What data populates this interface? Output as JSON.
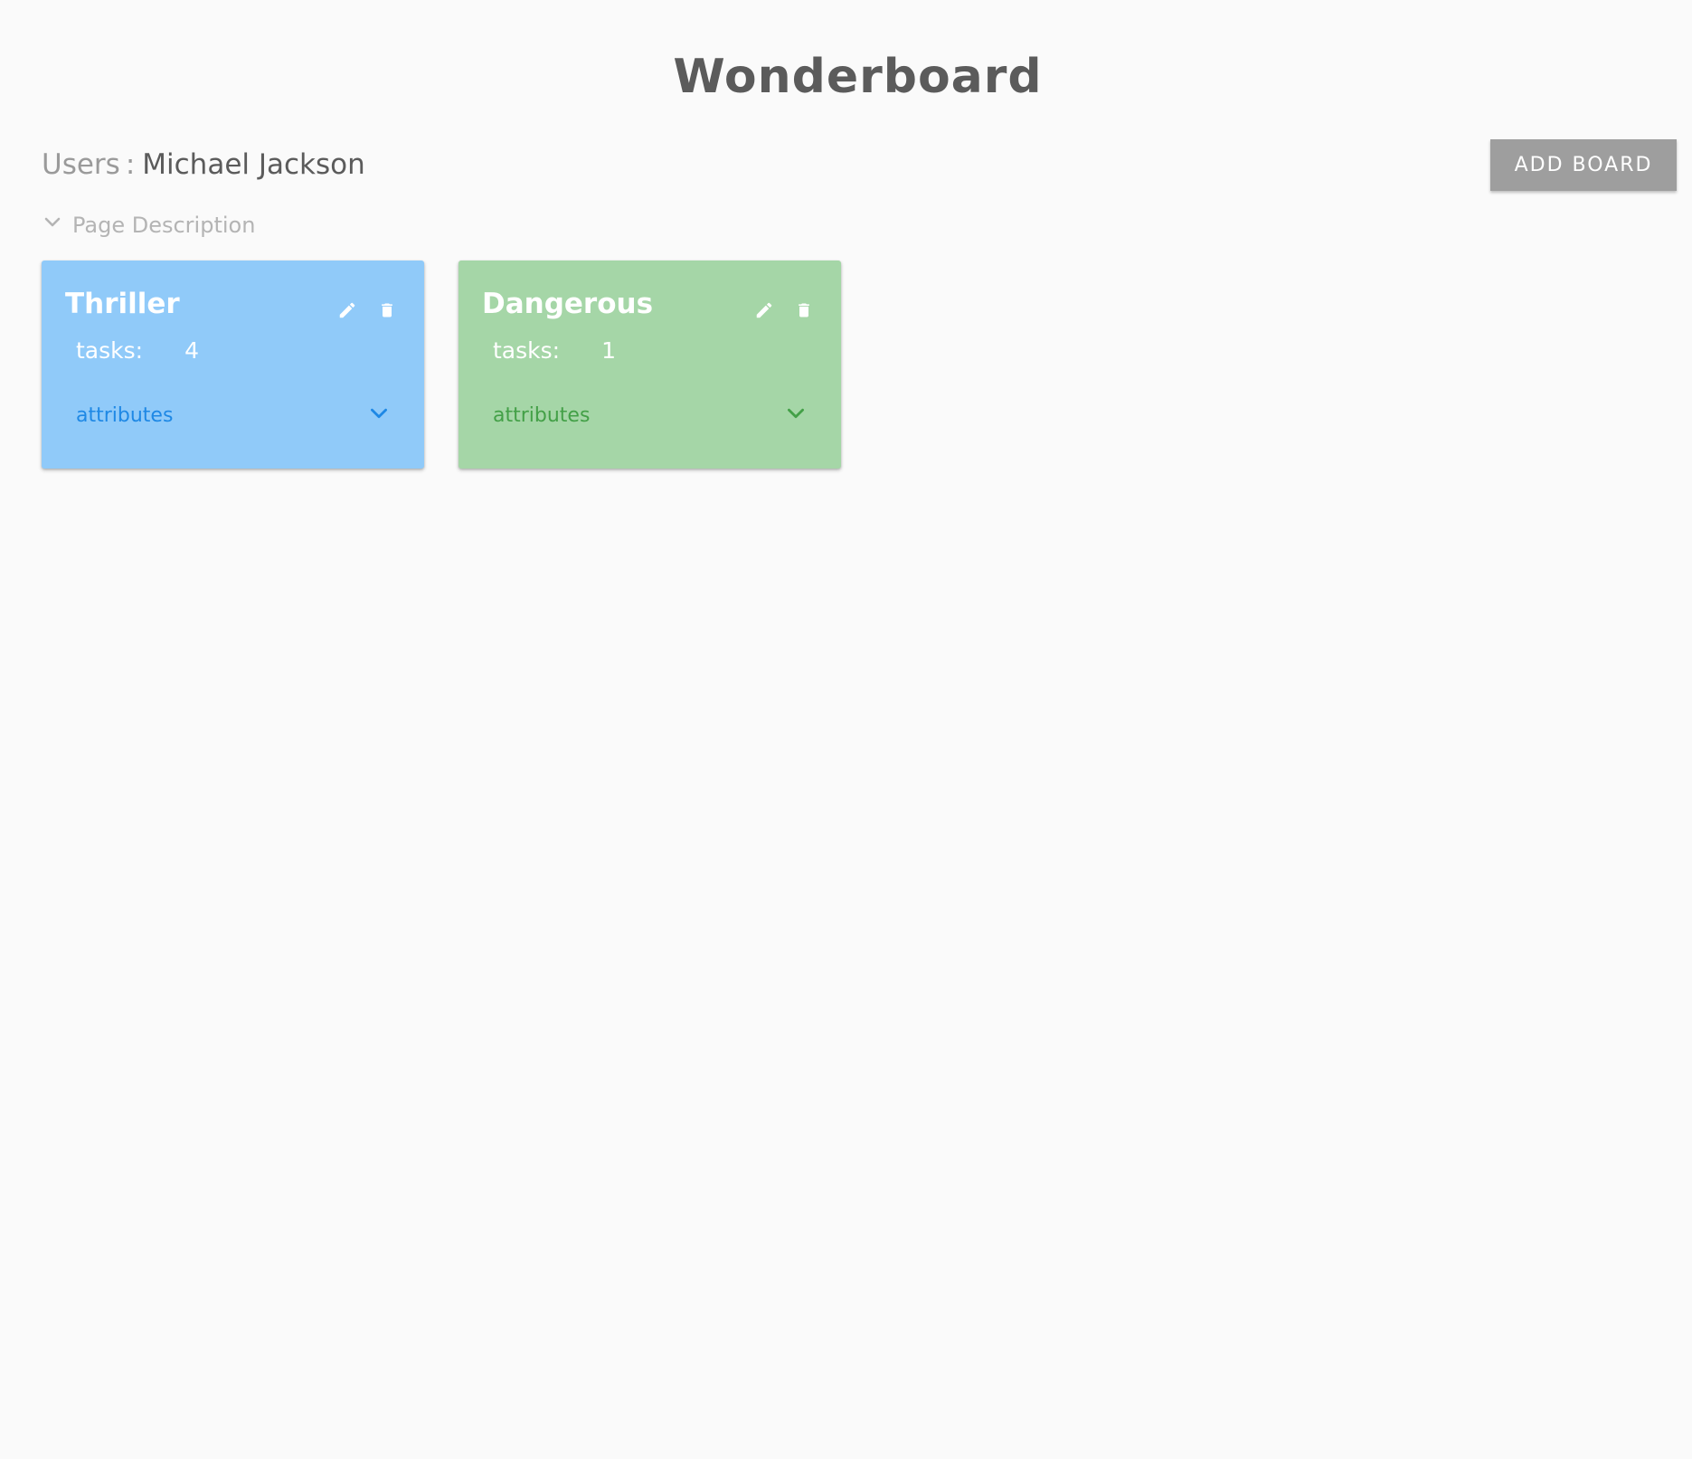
{
  "app": {
    "title": "Wonderboard"
  },
  "users": {
    "label": "Users",
    "separator": ":",
    "name": "Michael Jackson"
  },
  "toolbar": {
    "add_board_label": "ADD BOARD"
  },
  "page_description": {
    "label": "Page Description",
    "icon": "chevron-down-icon"
  },
  "boards": [
    {
      "title": "Thriller",
      "tasks_label": "tasks:",
      "tasks_count": "4",
      "attributes_label": "attributes",
      "color": "#90caf9",
      "accent": "#1e88e5"
    },
    {
      "title": "Dangerous",
      "tasks_label": "tasks:",
      "tasks_count": "1",
      "attributes_label": "attributes",
      "color": "#a5d6a7",
      "accent": "#43a047"
    }
  ],
  "icons": {
    "edit": "pencil-icon",
    "delete": "trash-icon",
    "expand": "chevron-down-icon"
  }
}
